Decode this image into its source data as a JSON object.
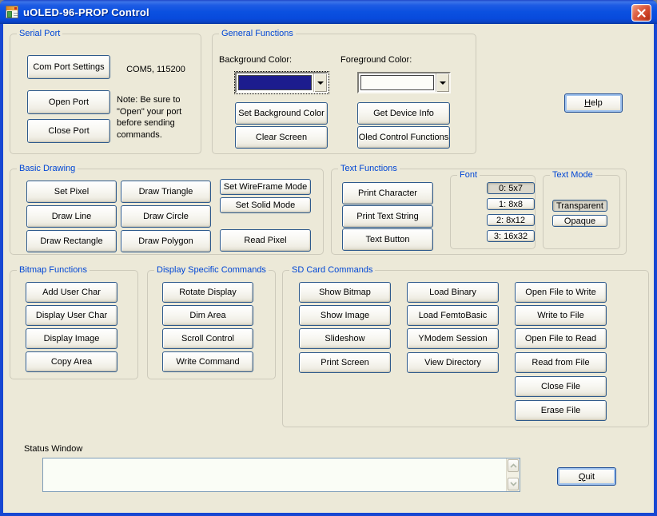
{
  "window": {
    "title": "uOLED-96-PROP Control"
  },
  "help_button": "Help",
  "quit_button": "Quit",
  "serial_port": {
    "label": "Serial Port",
    "com_port_settings": "Com Port Settings",
    "open_port": "Open Port",
    "close_port": "Close Port",
    "port_status": "COM5, 115200",
    "note": "Note:  Be sure to\n\"Open\" your port\nbefore sending\ncommands."
  },
  "general_functions": {
    "label": "General Functions",
    "background_color_label": "Background Color:",
    "foreground_color_label": "Foreground Color:",
    "background_color_value": "#1C1C8E",
    "foreground_color_value": "#FDFDF8",
    "set_background_color": "Set Background Color",
    "clear_screen": "Clear Screen",
    "get_device_info": "Get Device Info",
    "oled_control_functions": "Oled Control Functions"
  },
  "basic_drawing": {
    "label": "Basic Drawing",
    "set_pixel": "Set Pixel",
    "draw_triangle": "Draw Triangle",
    "draw_line": "Draw Line",
    "draw_circle": "Draw Circle",
    "draw_rectangle": "Draw Rectangle",
    "draw_polygon": "Draw Polygon",
    "set_wireframe_mode": "Set WireFrame Mode",
    "set_solid_mode": "Set Solid Mode",
    "read_pixel": "Read Pixel"
  },
  "text_functions": {
    "label": "Text Functions",
    "print_character": "Print Character",
    "print_text_string": "Print Text String",
    "text_button": "Text Button",
    "font": {
      "label": "Font",
      "options": [
        "0: 5x7",
        "1: 8x8",
        "2: 8x12",
        "3: 16x32"
      ],
      "selected": "0: 5x7"
    },
    "text_mode": {
      "label": "Text Mode",
      "options": [
        "Transparent",
        "Opaque"
      ],
      "selected": "Transparent"
    }
  },
  "bitmap_functions": {
    "label": "Bitmap Functions",
    "buttons": [
      "Add User Char",
      "Display User Char",
      "Display Image",
      "Copy Area"
    ]
  },
  "display_specific": {
    "label": "Display Specific Commands",
    "buttons": [
      "Rotate Display",
      "Dim Area",
      "Scroll Control",
      "Write Command"
    ]
  },
  "sd_card": {
    "label": "SD Card Commands",
    "col1": [
      "Show Bitmap",
      "Show Image",
      "Slideshow",
      "Print Screen"
    ],
    "col2": [
      "Load Binary",
      "Load FemtoBasic",
      "YModem Session",
      "View Directory"
    ],
    "col3": [
      "Open File to Write",
      "Write to File",
      "Open File to Read",
      "Read from File",
      "Close File",
      "Erase File"
    ]
  },
  "status_window": {
    "label": "Status Window",
    "content": ""
  }
}
